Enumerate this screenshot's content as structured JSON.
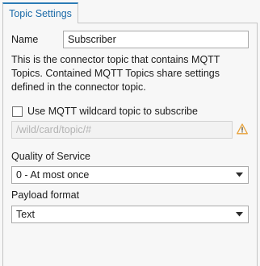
{
  "tab": {
    "label": "Topic Settings"
  },
  "name": {
    "label": "Name",
    "value": "Subscriber"
  },
  "description": "This is the connector topic that contains MQTT Topics. Contained MQTT Topics share settings defined in the connector topic.",
  "wildcard": {
    "checkbox_label": "Use MQTT wildcard topic to subscribe",
    "checked": false,
    "placeholder": "/wild/card/topic/#",
    "warning_icon": "warning-triangle-icon"
  },
  "qos": {
    "label": "Quality of Service",
    "selected": "0 - At most once"
  },
  "payload": {
    "label": "Payload format",
    "selected": "Text"
  },
  "colors": {
    "accent": "#2b7bb5",
    "warning": "#e8a23a"
  }
}
